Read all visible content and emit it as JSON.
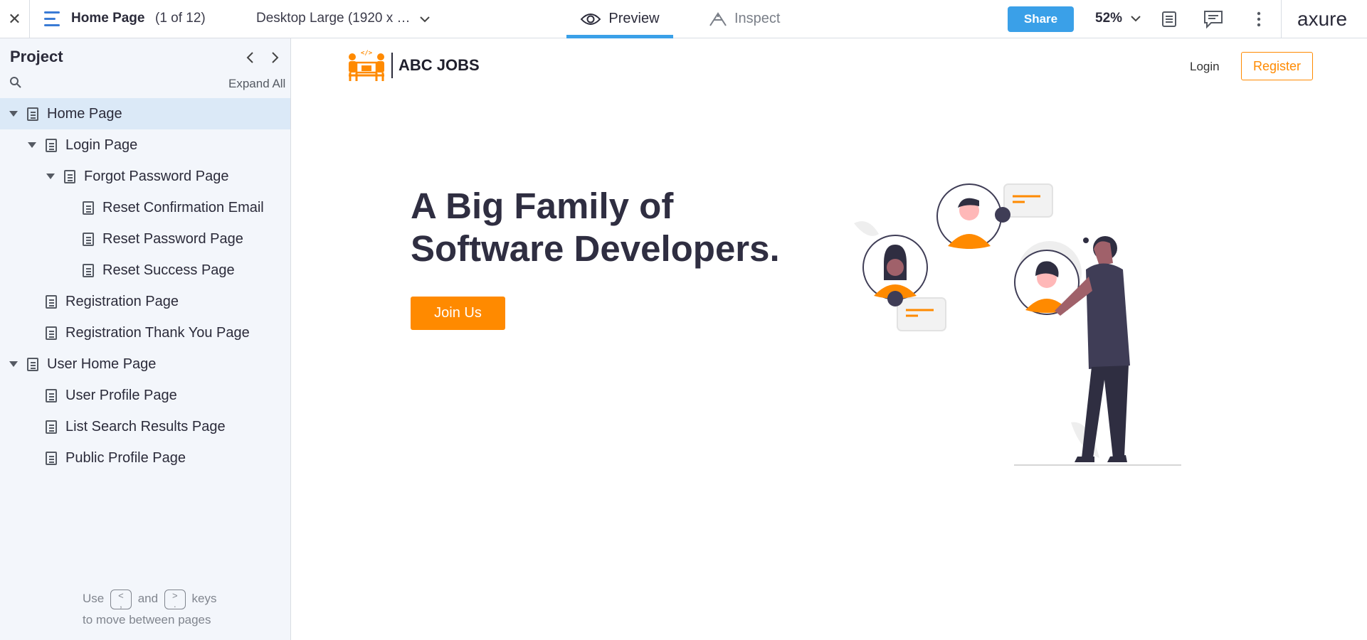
{
  "topbar": {
    "close_label": "✕",
    "page_title": "Home Page",
    "page_count": "(1 of 12)",
    "device": "Desktop Large (1920 x …",
    "tabs": [
      {
        "label": "Preview",
        "icon": "eye-icon",
        "active": true
      },
      {
        "label": "Inspect",
        "icon": "inspect-icon",
        "active": false
      }
    ],
    "share_label": "Share",
    "zoom": "52%",
    "brand": "axure"
  },
  "sidebar": {
    "title": "Project",
    "expand_all": "Expand All",
    "items": [
      {
        "label": "Home Page",
        "level": 0,
        "caret": true,
        "active": true
      },
      {
        "label": "Login Page",
        "level": 1,
        "caret": true
      },
      {
        "label": "Forgot Password Page",
        "level": 2,
        "caret": true
      },
      {
        "label": "Reset Confirmation Email",
        "level": 3,
        "caret": false
      },
      {
        "label": "Reset Password Page",
        "level": 3,
        "caret": false
      },
      {
        "label": "Reset Success Page",
        "level": 3,
        "caret": false
      },
      {
        "label": "Registration Page",
        "level": 1,
        "caret": false
      },
      {
        "label": "Registration Thank You Page",
        "level": 1,
        "caret": false
      },
      {
        "label": "User Home Page",
        "level": 0,
        "caret": true
      },
      {
        "label": "User Profile Page",
        "level": 1,
        "caret": false
      },
      {
        "label": "List Search Results Page",
        "level": 1,
        "caret": false
      },
      {
        "label": "Public Profile Page",
        "level": 1,
        "caret": false
      }
    ],
    "hint": {
      "use": "Use",
      "key_prev": "<\n,",
      "and": "and",
      "key_next": ">\n.",
      "keys": "keys",
      "line2": "to move between pages"
    }
  },
  "prototype": {
    "brand_name": "ABC JOBS",
    "brand_logo_text": "</>",
    "nav_login": "Login",
    "nav_register": "Register",
    "hero_title": "A Big Family of Software Developers.",
    "cta": "Join Us",
    "accent": "#ff8a00",
    "dark": "#2f2e41"
  },
  "colors": {
    "topbar_accent": "#3aa0e8",
    "sidebar_bg": "#f3f6fb",
    "active_row": "#dbe9f7"
  }
}
